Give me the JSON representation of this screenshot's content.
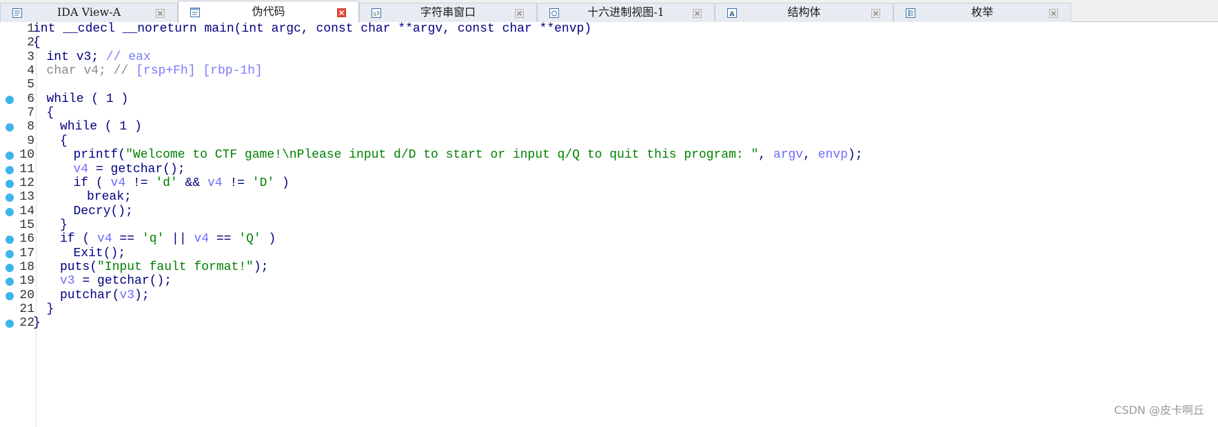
{
  "tabs": [
    {
      "label": "IDA View-A",
      "icon": "disassembly-view-icon",
      "active": false
    },
    {
      "label": "伪代码",
      "icon": "pseudocode-icon",
      "active": true
    },
    {
      "label": "字符串窗口",
      "icon": "strings-window-icon",
      "active": false
    },
    {
      "label": "十六进制视图-1",
      "icon": "hex-view-icon",
      "active": false
    },
    {
      "label": "结构体",
      "icon": "structures-icon",
      "active": false
    },
    {
      "label": "枚举",
      "icon": "enums-icon",
      "active": false
    }
  ],
  "code": {
    "lines": [
      {
        "num": "1",
        "bp": false,
        "indent": 0,
        "segs": [
          [
            "id",
            "int __cdecl __noreturn main(int argc, const char **argv, const char **envp)"
          ]
        ]
      },
      {
        "num": "2",
        "bp": false,
        "indent": 0,
        "segs": [
          [
            "id",
            "{"
          ]
        ]
      },
      {
        "num": "3",
        "bp": false,
        "indent": 1,
        "segs": [
          [
            "id",
            "int v3; "
          ],
          [
            "cm",
            "// eax"
          ]
        ]
      },
      {
        "num": "4",
        "bp": false,
        "indent": 1,
        "segs": [
          [
            "gray",
            "char v4; // "
          ],
          [
            "cm",
            "[rsp+Fh] [rbp-1h]"
          ]
        ]
      },
      {
        "num": "5",
        "bp": false,
        "indent": 0,
        "segs": []
      },
      {
        "num": "6",
        "bp": true,
        "indent": 1,
        "segs": [
          [
            "kw",
            "while ( 1 )"
          ]
        ]
      },
      {
        "num": "7",
        "bp": false,
        "indent": 1,
        "segs": [
          [
            "id",
            "{"
          ]
        ]
      },
      {
        "num": "8",
        "bp": true,
        "indent": 2,
        "segs": [
          [
            "kw",
            "while ( 1 )"
          ]
        ]
      },
      {
        "num": "9",
        "bp": false,
        "indent": 2,
        "segs": [
          [
            "id",
            "{"
          ]
        ]
      },
      {
        "num": "10",
        "bp": true,
        "indent": 3,
        "segs": [
          [
            "id",
            "printf("
          ],
          [
            "str",
            "\"Welcome to CTF game!\\nPlease input d/D to start or input q/Q to quit this program: \""
          ],
          [
            "id",
            ", "
          ],
          [
            "var",
            "argv"
          ],
          [
            "id",
            ", "
          ],
          [
            "var",
            "envp"
          ],
          [
            "id",
            ");"
          ]
        ]
      },
      {
        "num": "11",
        "bp": true,
        "indent": 3,
        "segs": [
          [
            "var",
            "v4"
          ],
          [
            "id",
            " = getchar();"
          ]
        ]
      },
      {
        "num": "12",
        "bp": true,
        "indent": 3,
        "segs": [
          [
            "kw",
            "if ( "
          ],
          [
            "var",
            "v4"
          ],
          [
            "id",
            " != "
          ],
          [
            "str",
            "'d'"
          ],
          [
            "id",
            " && "
          ],
          [
            "var",
            "v4"
          ],
          [
            "id",
            " != "
          ],
          [
            "str",
            "'D'"
          ],
          [
            "id",
            " )"
          ]
        ]
      },
      {
        "num": "13",
        "bp": true,
        "indent": 4,
        "segs": [
          [
            "kw",
            "break;"
          ]
        ]
      },
      {
        "num": "14",
        "bp": true,
        "indent": 3,
        "segs": [
          [
            "id",
            "Decry();"
          ]
        ]
      },
      {
        "num": "15",
        "bp": false,
        "indent": 2,
        "segs": [
          [
            "id",
            "}"
          ]
        ]
      },
      {
        "num": "16",
        "bp": true,
        "indent": 2,
        "segs": [
          [
            "kw",
            "if ( "
          ],
          [
            "var",
            "v4"
          ],
          [
            "id",
            " == "
          ],
          [
            "str",
            "'q'"
          ],
          [
            "id",
            " || "
          ],
          [
            "var",
            "v4"
          ],
          [
            "id",
            " == "
          ],
          [
            "str",
            "'Q'"
          ],
          [
            "id",
            " )"
          ]
        ]
      },
      {
        "num": "17",
        "bp": true,
        "indent": 3,
        "segs": [
          [
            "id",
            "Exit();"
          ]
        ]
      },
      {
        "num": "18",
        "bp": true,
        "indent": 2,
        "segs": [
          [
            "id",
            "puts("
          ],
          [
            "str",
            "\"Input fault format!\""
          ],
          [
            "id",
            ");"
          ]
        ]
      },
      {
        "num": "19",
        "bp": true,
        "indent": 2,
        "segs": [
          [
            "var",
            "v3"
          ],
          [
            "id",
            " = getchar();"
          ]
        ]
      },
      {
        "num": "20",
        "bp": true,
        "indent": 2,
        "segs": [
          [
            "id",
            "putchar("
          ],
          [
            "var",
            "v3"
          ],
          [
            "id",
            ");"
          ]
        ]
      },
      {
        "num": "21",
        "bp": false,
        "indent": 1,
        "segs": [
          [
            "id",
            "}"
          ]
        ]
      },
      {
        "num": "22",
        "bp": true,
        "indent": 0,
        "segs": [
          [
            "id",
            "}"
          ]
        ]
      }
    ]
  },
  "watermark": "CSDN @皮卡啊丘",
  "colors": {
    "keyword": "#000080",
    "variable": "#6c6cff",
    "string": "#008000",
    "breakpoint": "#3fb4ec"
  }
}
